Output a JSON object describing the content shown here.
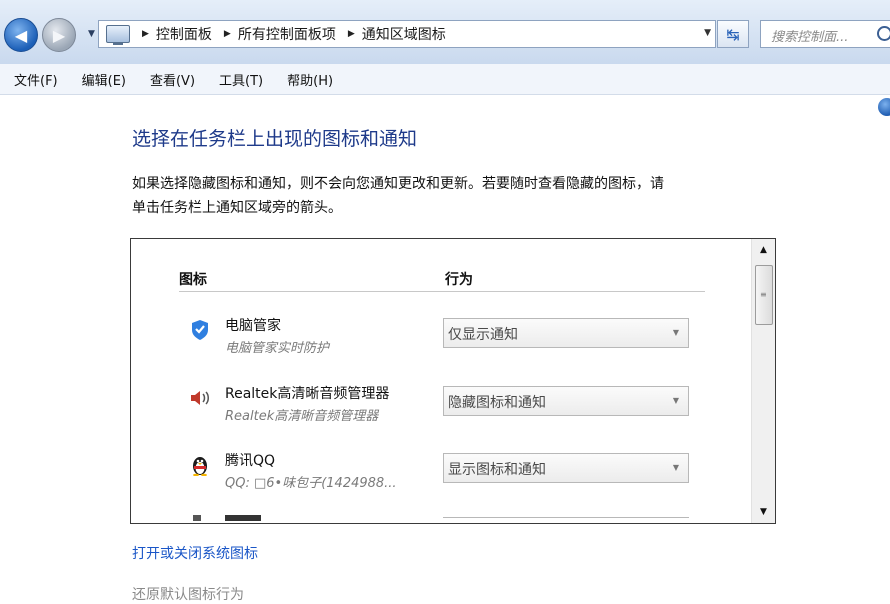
{
  "address_bar": {
    "breadcrumbs": [
      "控制面板",
      "所有控制面板项",
      "通知区域图标"
    ],
    "search_placeholder": "搜索控制面..."
  },
  "menu": [
    "文件(F)",
    "编辑(E)",
    "查看(V)",
    "工具(T)",
    "帮助(H)"
  ],
  "main": {
    "title": "选择在任务栏上出现的图标和通知",
    "description_line1": "如果选择隐藏图标和通知，则不会向您通知更改和更新。若要随时查看隐藏的图标，请",
    "description_line2": "单击任务栏上通知区域旁的箭头。",
    "table": {
      "col_icon": "图标",
      "col_behavior": "行为",
      "rows": [
        {
          "icon": "shield-icon",
          "name": "电脑管家",
          "subtitle": "电脑管家实时防护",
          "behavior": "仅显示通知"
        },
        {
          "icon": "speaker-icon",
          "name": "Realtek高清晰音频管理器",
          "subtitle": "Realtek高清晰音频管理器",
          "behavior": "隐藏图标和通知"
        },
        {
          "icon": "qq-penguin-icon",
          "name": "腾讯QQ",
          "subtitle": "QQ: □6•味包子(1424988...",
          "behavior": "显示图标和通知"
        }
      ]
    },
    "links": {
      "system_icons": "打开或关闭系统图标",
      "restore_default": "还原默认图标行为"
    }
  },
  "colors": {
    "link": "#1a56c7",
    "title": "#1e3a8a",
    "shield": "#2f7fe0"
  }
}
